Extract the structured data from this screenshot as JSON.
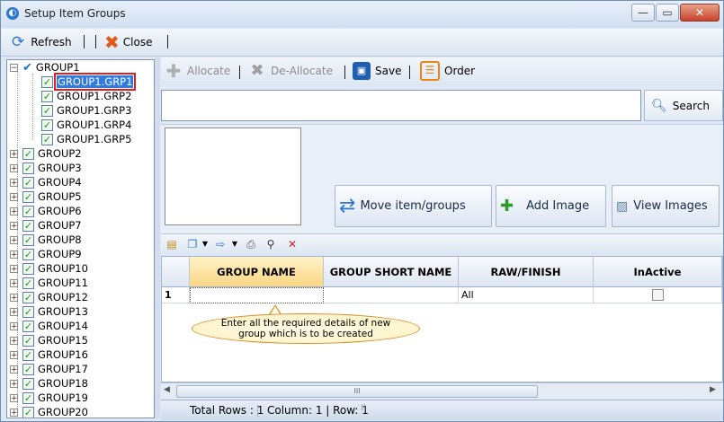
{
  "window": {
    "title": "Setup Item Groups",
    "minimize": "—",
    "maximize": "▭",
    "close": "✕"
  },
  "toolbar": {
    "refresh_label": "Refresh",
    "close_label": "Close"
  },
  "tree": {
    "root": "GROUP1",
    "children": [
      "GROUP1.GRP1",
      "GROUP1.GRP2",
      "GROUP1.GRP3",
      "GROUP1.GRP4",
      "GROUP1.GRP5"
    ],
    "groups": [
      "GROUP2",
      "GROUP3",
      "GROUP4",
      "GROUP5",
      "GROUP6",
      "GROUP7",
      "GROUP8",
      "GROUP9",
      "GROUP10",
      "GROUP11",
      "GROUP12",
      "GROUP13",
      "GROUP14",
      "GROUP15",
      "GROUP16",
      "GROUP17",
      "GROUP18",
      "GROUP19",
      "GROUP20"
    ]
  },
  "actions": {
    "allocate": "Allocate",
    "deallocate": "De-Allocate",
    "save": "Save",
    "order": "Order"
  },
  "search": {
    "value": "",
    "button": "Search"
  },
  "image_buttons": {
    "move": "Move item/groups",
    "add": "Add Image",
    "view": "View Images"
  },
  "grid": {
    "headers": [
      "GROUP NAME",
      "GROUP SHORT NAME",
      "RAW/FINISH",
      "InActive"
    ],
    "row": {
      "number": "1",
      "group_name": "",
      "short_name": "",
      "raw_finish": "All",
      "inactive": false
    },
    "callout": "Enter all the required details of new group which is to be created"
  },
  "status": {
    "total_rows": "Total Rows : 1",
    "position": "Column: 1 | Row: 1"
  },
  "scrollbar_grip": "III",
  "colors": {
    "selection": "#2f7cdb",
    "highlight_border": "#e02020",
    "active_header": "#fbd682"
  }
}
